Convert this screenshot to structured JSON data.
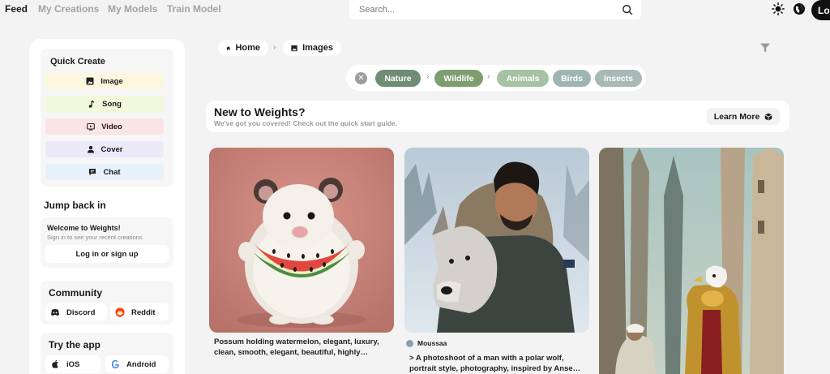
{
  "nav": {
    "tabs": [
      {
        "label": "Feed",
        "active": true
      },
      {
        "label": "My Creations",
        "active": false
      },
      {
        "label": "My Models",
        "active": false
      },
      {
        "label": "Train Model",
        "active": false
      }
    ],
    "search_placeholder": "Search...",
    "login_label": "Log"
  },
  "sidebar": {
    "quick_create": {
      "title": "Quick Create",
      "items": [
        {
          "label": "Image",
          "icon": "image-icon",
          "color": "#fbf6dd"
        },
        {
          "label": "Song",
          "icon": "music-note-icon",
          "color": "#f2f8dc"
        },
        {
          "label": "Video",
          "icon": "video-icon",
          "color": "#fbe4e4"
        },
        {
          "label": "Cover",
          "icon": "user-icon",
          "color": "#ece9fb"
        },
        {
          "label": "Chat",
          "icon": "chat-icon",
          "color": "#e6f1fc"
        }
      ]
    },
    "jump_back": {
      "title": "Jump back in",
      "welcome_title": "Welcome to Weights!",
      "welcome_sub": "Sign in to see your recent creations",
      "login_label": "Log in or sign up"
    },
    "community": {
      "title": "Community",
      "discord": "Discord",
      "reddit": "Reddit"
    },
    "apps": {
      "title": "Try the app",
      "ios": "iOS",
      "android": "Android"
    }
  },
  "breadcrumb": {
    "home": "Home",
    "images": "Images"
  },
  "chips": {
    "items": [
      {
        "label": "Nature",
        "color": "#6f8c74"
      },
      {
        "label": "Wildlife",
        "color": "#7e9e70"
      },
      {
        "label": "Animals",
        "color": "#a5c2a3"
      },
      {
        "label": "Birds",
        "color": "#9fb5b3"
      },
      {
        "label": "Insects",
        "color": "#a8b9b6"
      }
    ]
  },
  "banner": {
    "title": "New to Weights?",
    "subtitle": "We've got you covered! Check out the quick start guide.",
    "button": "Learn More"
  },
  "cards": [
    {
      "caption_line1": "Possum holding watermelon, elegant, luxury,",
      "caption_line2": "clean, smooth, elegant, beautiful, highly…"
    },
    {
      "author": "Moussaa",
      "caption_line1": "> A photoshoot of a man with a polar wolf,",
      "caption_line2": "portrait style, photography, inspired by Anse…"
    },
    {}
  ]
}
